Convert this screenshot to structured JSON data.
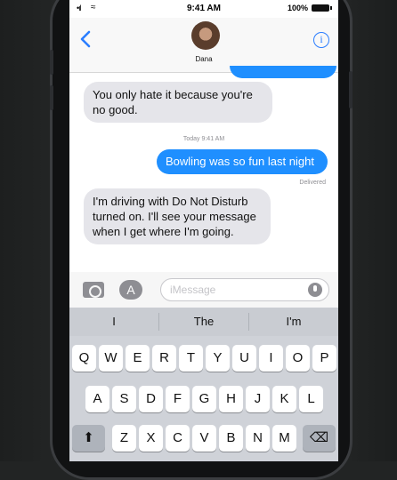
{
  "status_bar": {
    "time": "9:41 AM",
    "battery": "100%",
    "signal_glyph": "•ıl",
    "wifi_glyph": "≈"
  },
  "header": {
    "contact_name": "Dana",
    "back_icon": "chevron-left-icon",
    "info_icon": "info-icon",
    "info_glyph": "i"
  },
  "conversation": {
    "messages": [
      {
        "direction": "incoming",
        "text": "You only hate it because you're no good."
      },
      {
        "direction": "outgoing",
        "text": "Bowling was so fun last night"
      },
      {
        "direction": "incoming",
        "text": "I'm driving with Do Not Disturb turned on. I'll see your message when I get where I'm going."
      }
    ],
    "timestamp": "Today 9:41 AM",
    "delivered_label": "Delivered"
  },
  "input_bar": {
    "placeholder": "iMessage",
    "camera_icon": "camera-icon",
    "appstore_icon": "app-store-icon",
    "appstore_glyph": "A",
    "mic_icon": "microphone-icon"
  },
  "keyboard": {
    "suggestions": [
      "I",
      "The",
      "I'm"
    ],
    "row1": [
      "Q",
      "W",
      "E",
      "R",
      "T",
      "Y",
      "U",
      "I",
      "O",
      "P"
    ],
    "row2": [
      "A",
      "S",
      "D",
      "F",
      "G",
      "H",
      "J",
      "K",
      "L"
    ],
    "row3": [
      "Z",
      "X",
      "C",
      "V",
      "B",
      "N",
      "M"
    ],
    "shift_glyph": "⬆",
    "delete_glyph": "⌫"
  },
  "colors": {
    "accent": "#1f8fff",
    "incoming_bubble": "#e5e5ea",
    "keyboard_bg": "#cfd2d8"
  }
}
